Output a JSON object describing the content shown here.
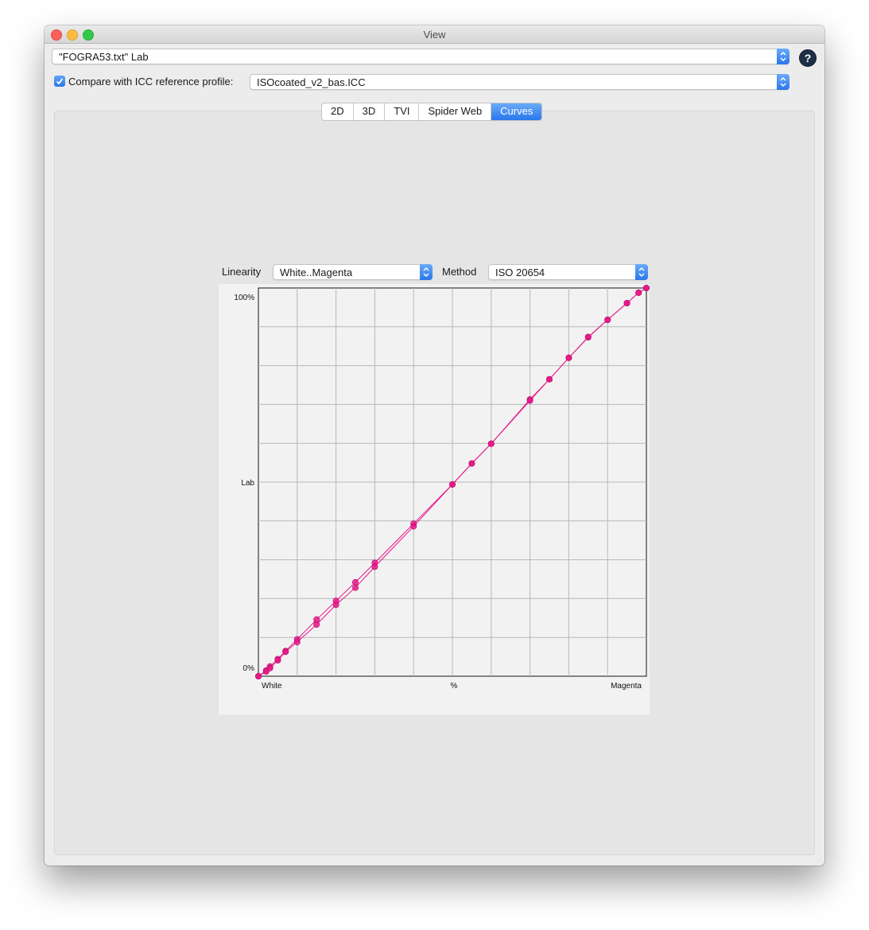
{
  "window": {
    "title": "View"
  },
  "source": {
    "selected": "\"FOGRA53.txt\" Lab"
  },
  "compare": {
    "checked": true,
    "label": "Compare with ICC reference profile:",
    "profile": "ISOcoated_v2_bas.ICC"
  },
  "help": {
    "icon": "help-icon",
    "glyph": "?"
  },
  "tabs": [
    {
      "label": "2D",
      "active": false
    },
    {
      "label": "3D",
      "active": false
    },
    {
      "label": "TVI",
      "active": false
    },
    {
      "label": "Spider Web",
      "active": false
    },
    {
      "label": "Curves",
      "active": true
    }
  ],
  "controls": {
    "linearity_label": "Linearity",
    "linearity_value": "White..Magenta",
    "method_label": "Method",
    "method_value": "ISO 20654"
  },
  "colors": {
    "accent": "#2a77ec",
    "curve": "#e8168a"
  },
  "chart_data": {
    "type": "line",
    "x_start_label": "White",
    "x_mid_label": "%",
    "x_end_label": "Magenta",
    "y_top_label": "100%",
    "y_mid_label": "Lab",
    "y_bottom_label": "0%",
    "xlim": [
      0,
      100
    ],
    "ylim": [
      0,
      100
    ],
    "grid": true,
    "series": [
      {
        "x": [
          0,
          2,
          3,
          5,
          7,
          10,
          15,
          20,
          25,
          30,
          40,
          50,
          55,
          60,
          70,
          75,
          80,
          85,
          90,
          95,
          98,
          100
        ],
        "y": [
          0,
          1.5,
          2.5,
          4.4,
          6.5,
          9.5,
          14.6,
          19.4,
          24.2,
          29.2,
          39.3,
          49.4,
          54.8,
          59.9,
          71.3,
          76.5,
          82.0,
          87.3,
          91.8,
          96.1,
          98.8,
          100
        ]
      },
      {
        "x": [
          0,
          2,
          3,
          5,
          7,
          10,
          15,
          20,
          25,
          30,
          40,
          50,
          55,
          60,
          70,
          75,
          80,
          85,
          90,
          95,
          98,
          100
        ],
        "y": [
          0,
          1.2,
          2.1,
          4.1,
          6.3,
          8.8,
          13.3,
          18.4,
          22.8,
          28.2,
          38.6,
          49.4,
          54.8,
          59.9,
          71.0,
          76.5,
          82.0,
          87.4,
          91.8,
          96.1,
          98.8,
          100
        ]
      }
    ]
  }
}
